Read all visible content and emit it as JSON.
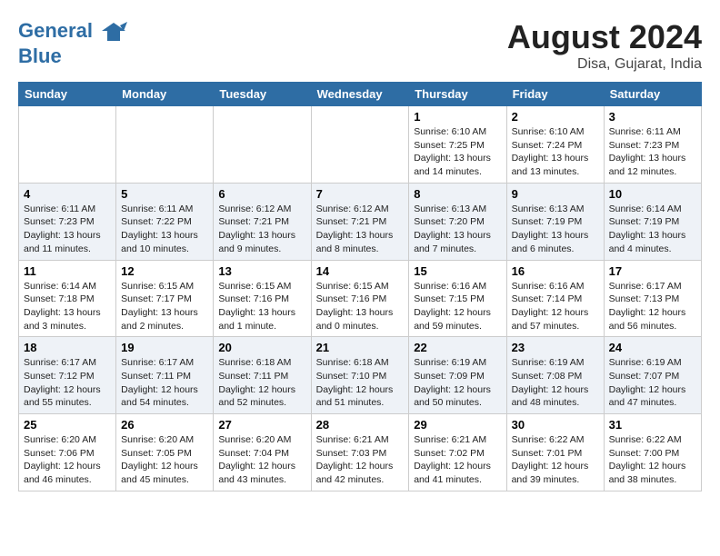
{
  "header": {
    "logo_line1": "General",
    "logo_line2": "Blue",
    "month_year": "August 2024",
    "location": "Disa, Gujarat, India"
  },
  "weekdays": [
    "Sunday",
    "Monday",
    "Tuesday",
    "Wednesday",
    "Thursday",
    "Friday",
    "Saturday"
  ],
  "weeks": [
    [
      {
        "day": "",
        "info": ""
      },
      {
        "day": "",
        "info": ""
      },
      {
        "day": "",
        "info": ""
      },
      {
        "day": "",
        "info": ""
      },
      {
        "day": "1",
        "info": "Sunrise: 6:10 AM\nSunset: 7:25 PM\nDaylight: 13 hours\nand 14 minutes."
      },
      {
        "day": "2",
        "info": "Sunrise: 6:10 AM\nSunset: 7:24 PM\nDaylight: 13 hours\nand 13 minutes."
      },
      {
        "day": "3",
        "info": "Sunrise: 6:11 AM\nSunset: 7:23 PM\nDaylight: 13 hours\nand 12 minutes."
      }
    ],
    [
      {
        "day": "4",
        "info": "Sunrise: 6:11 AM\nSunset: 7:23 PM\nDaylight: 13 hours\nand 11 minutes."
      },
      {
        "day": "5",
        "info": "Sunrise: 6:11 AM\nSunset: 7:22 PM\nDaylight: 13 hours\nand 10 minutes."
      },
      {
        "day": "6",
        "info": "Sunrise: 6:12 AM\nSunset: 7:21 PM\nDaylight: 13 hours\nand 9 minutes."
      },
      {
        "day": "7",
        "info": "Sunrise: 6:12 AM\nSunset: 7:21 PM\nDaylight: 13 hours\nand 8 minutes."
      },
      {
        "day": "8",
        "info": "Sunrise: 6:13 AM\nSunset: 7:20 PM\nDaylight: 13 hours\nand 7 minutes."
      },
      {
        "day": "9",
        "info": "Sunrise: 6:13 AM\nSunset: 7:19 PM\nDaylight: 13 hours\nand 6 minutes."
      },
      {
        "day": "10",
        "info": "Sunrise: 6:14 AM\nSunset: 7:19 PM\nDaylight: 13 hours\nand 4 minutes."
      }
    ],
    [
      {
        "day": "11",
        "info": "Sunrise: 6:14 AM\nSunset: 7:18 PM\nDaylight: 13 hours\nand 3 minutes."
      },
      {
        "day": "12",
        "info": "Sunrise: 6:15 AM\nSunset: 7:17 PM\nDaylight: 13 hours\nand 2 minutes."
      },
      {
        "day": "13",
        "info": "Sunrise: 6:15 AM\nSunset: 7:16 PM\nDaylight: 13 hours\nand 1 minute."
      },
      {
        "day": "14",
        "info": "Sunrise: 6:15 AM\nSunset: 7:16 PM\nDaylight: 13 hours\nand 0 minutes."
      },
      {
        "day": "15",
        "info": "Sunrise: 6:16 AM\nSunset: 7:15 PM\nDaylight: 12 hours\nand 59 minutes."
      },
      {
        "day": "16",
        "info": "Sunrise: 6:16 AM\nSunset: 7:14 PM\nDaylight: 12 hours\nand 57 minutes."
      },
      {
        "day": "17",
        "info": "Sunrise: 6:17 AM\nSunset: 7:13 PM\nDaylight: 12 hours\nand 56 minutes."
      }
    ],
    [
      {
        "day": "18",
        "info": "Sunrise: 6:17 AM\nSunset: 7:12 PM\nDaylight: 12 hours\nand 55 minutes."
      },
      {
        "day": "19",
        "info": "Sunrise: 6:17 AM\nSunset: 7:11 PM\nDaylight: 12 hours\nand 54 minutes."
      },
      {
        "day": "20",
        "info": "Sunrise: 6:18 AM\nSunset: 7:11 PM\nDaylight: 12 hours\nand 52 minutes."
      },
      {
        "day": "21",
        "info": "Sunrise: 6:18 AM\nSunset: 7:10 PM\nDaylight: 12 hours\nand 51 minutes."
      },
      {
        "day": "22",
        "info": "Sunrise: 6:19 AM\nSunset: 7:09 PM\nDaylight: 12 hours\nand 50 minutes."
      },
      {
        "day": "23",
        "info": "Sunrise: 6:19 AM\nSunset: 7:08 PM\nDaylight: 12 hours\nand 48 minutes."
      },
      {
        "day": "24",
        "info": "Sunrise: 6:19 AM\nSunset: 7:07 PM\nDaylight: 12 hours\nand 47 minutes."
      }
    ],
    [
      {
        "day": "25",
        "info": "Sunrise: 6:20 AM\nSunset: 7:06 PM\nDaylight: 12 hours\nand 46 minutes."
      },
      {
        "day": "26",
        "info": "Sunrise: 6:20 AM\nSunset: 7:05 PM\nDaylight: 12 hours\nand 45 minutes."
      },
      {
        "day": "27",
        "info": "Sunrise: 6:20 AM\nSunset: 7:04 PM\nDaylight: 12 hours\nand 43 minutes."
      },
      {
        "day": "28",
        "info": "Sunrise: 6:21 AM\nSunset: 7:03 PM\nDaylight: 12 hours\nand 42 minutes."
      },
      {
        "day": "29",
        "info": "Sunrise: 6:21 AM\nSunset: 7:02 PM\nDaylight: 12 hours\nand 41 minutes."
      },
      {
        "day": "30",
        "info": "Sunrise: 6:22 AM\nSunset: 7:01 PM\nDaylight: 12 hours\nand 39 minutes."
      },
      {
        "day": "31",
        "info": "Sunrise: 6:22 AM\nSunset: 7:00 PM\nDaylight: 12 hours\nand 38 minutes."
      }
    ]
  ]
}
